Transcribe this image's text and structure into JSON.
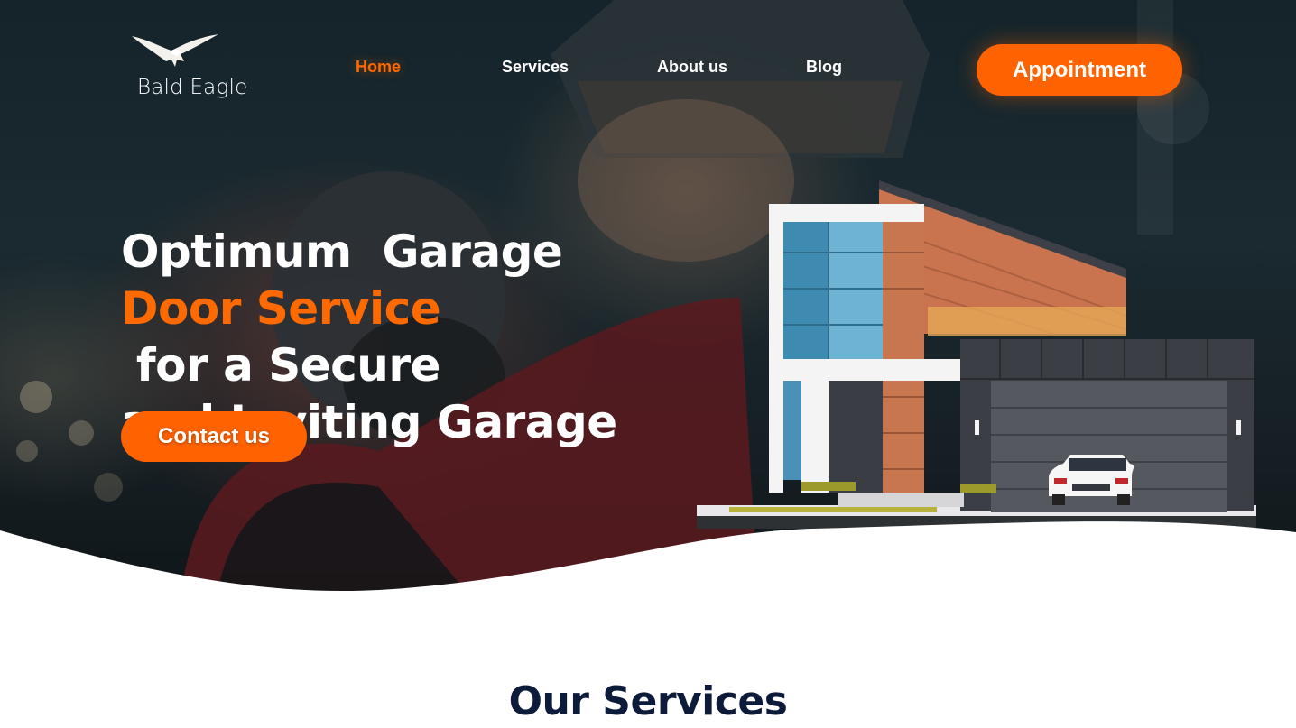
{
  "brand": {
    "name": "Bald Eagle",
    "logo_icon": "eagle-icon"
  },
  "nav": {
    "items": [
      {
        "label": "Home",
        "active": true
      },
      {
        "label": "Services",
        "active": false
      },
      {
        "label": "About us",
        "active": false
      },
      {
        "label": "Blog",
        "active": false
      }
    ],
    "cta_label": "Appointment"
  },
  "hero": {
    "headline_line1": "Optimum  Garage",
    "headline_accent": "Door Service",
    "headline_line2_rest": " for a Secure",
    "headline_line3": "and Inviting Garage",
    "cta_label": "Contact us",
    "image": "modern-house-with-garage-illustration"
  },
  "services": {
    "title": "Our Services"
  },
  "colors": {
    "accent": "#ff6200",
    "heading_dark": "#0d1b3a",
    "text_light": "#ffffff"
  }
}
